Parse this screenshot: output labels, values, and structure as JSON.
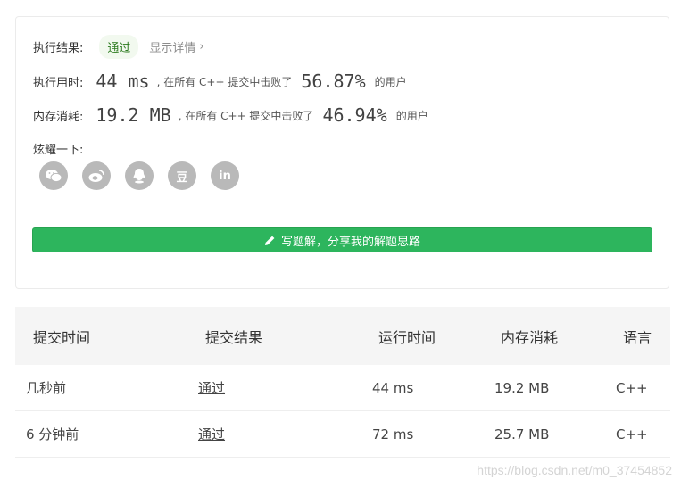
{
  "result": {
    "label": "执行结果:",
    "status": "通过",
    "details_link": "显示详情",
    "details_chevron": "›"
  },
  "runtime": {
    "label": "执行用时:",
    "value": "44 ms",
    "middle_text": ", 在所有 C++ 提交中击败了",
    "percent": "56.87%",
    "tail_text": "的用户"
  },
  "memory": {
    "label": "内存消耗:",
    "value": "19.2 MB",
    "middle_text": ", 在所有 C++ 提交中击败了",
    "percent": "46.94%",
    "tail_text": "的用户"
  },
  "share": {
    "label": "炫耀一下:",
    "icons": [
      "wechat-icon",
      "weibo-icon",
      "qq-icon",
      "douban-icon",
      "linkedin-icon"
    ],
    "douban_text": "豆",
    "linkedin_text": "in"
  },
  "solution_button": {
    "label": "写题解，分享我的解题思路"
  },
  "table": {
    "headers": [
      "提交时间",
      "提交结果",
      "运行时间",
      "内存消耗",
      "语言"
    ],
    "rows": [
      [
        "几秒前",
        "通过",
        "44 ms",
        "19.2 MB",
        "C++"
      ],
      [
        "6 分钟前",
        "通过",
        "72 ms",
        "25.7 MB",
        "C++"
      ]
    ]
  },
  "watermark": "https://blog.csdn.net/m0_37454852",
  "colors": {
    "accent_green": "#2db55d",
    "status_green": "#5cb85c",
    "icon_grey": "#b9b9b9"
  }
}
